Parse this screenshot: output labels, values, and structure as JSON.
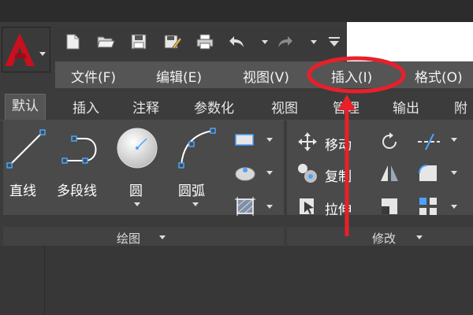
{
  "menubar": {
    "items": [
      {
        "label": "文件(F)"
      },
      {
        "label": "编辑(E)"
      },
      {
        "label": "视图(V)"
      },
      {
        "label": "插入(I)"
      },
      {
        "label": "格式(O)"
      }
    ]
  },
  "ribbon_tabs": [
    {
      "label": "默认"
    },
    {
      "label": "插入"
    },
    {
      "label": "注释"
    },
    {
      "label": "参数化"
    },
    {
      "label": "视图"
    },
    {
      "label": "管理"
    },
    {
      "label": "输出"
    },
    {
      "label": "附"
    }
  ],
  "draw_panel": {
    "title": "绘图",
    "tools": [
      {
        "label": "直线"
      },
      {
        "label": "多段线"
      },
      {
        "label": "圆"
      },
      {
        "label": "圆弧"
      }
    ]
  },
  "modify_panel": {
    "title": "修改",
    "tools": [
      {
        "label": "移动"
      },
      {
        "label": "复制"
      },
      {
        "label": "拉伸"
      }
    ]
  },
  "annotation": {
    "highlight_color": "#e8202a"
  },
  "colors": {
    "app_logo_red": "#c8101e",
    "menubar_bg": "#555555"
  }
}
